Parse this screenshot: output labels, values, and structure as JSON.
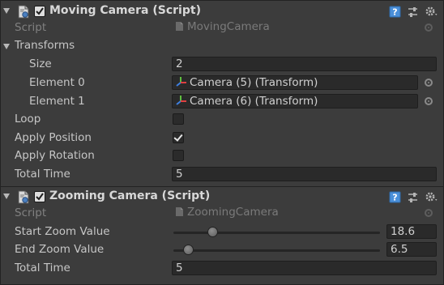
{
  "components": [
    {
      "title": "Moving Camera (Script)",
      "enabled": true,
      "script": {
        "label": "Script",
        "value": "MovingCamera"
      },
      "transforms": {
        "label": "Transforms",
        "size": {
          "label": "Size",
          "value": "2"
        },
        "elements": [
          {
            "label": "Element 0",
            "value": "Camera (5) (Transform)"
          },
          {
            "label": "Element 1",
            "value": "Camera (6) (Transform)"
          }
        ]
      },
      "loop": {
        "label": "Loop",
        "checked": false
      },
      "apply_position": {
        "label": "Apply Position",
        "checked": true
      },
      "apply_rotation": {
        "label": "Apply Rotation",
        "checked": false
      },
      "total_time": {
        "label": "Total Time",
        "value": "5"
      }
    },
    {
      "title": "Zooming Camera (Script)",
      "enabled": true,
      "script": {
        "label": "Script",
        "value": "ZoomingCamera"
      },
      "start_zoom": {
        "label": "Start Zoom Value",
        "value": "18.6",
        "slider_fraction": 0.19
      },
      "end_zoom": {
        "label": "End Zoom Value",
        "value": "6.5",
        "slider_fraction": 0.07
      },
      "total_time": {
        "label": "Total Time",
        "value": "5"
      }
    }
  ],
  "icons": {
    "help": "help-book-icon",
    "preset": "preset-sliders-icon",
    "settings": "gear-icon",
    "script": "script-file-icon",
    "transform": "transform-axes-icon",
    "object_picker": "object-picker-target-icon"
  },
  "colors": {
    "background": "#3c3c3c",
    "field": "#2a2a2a",
    "help_icon": "#4a8fd9"
  }
}
